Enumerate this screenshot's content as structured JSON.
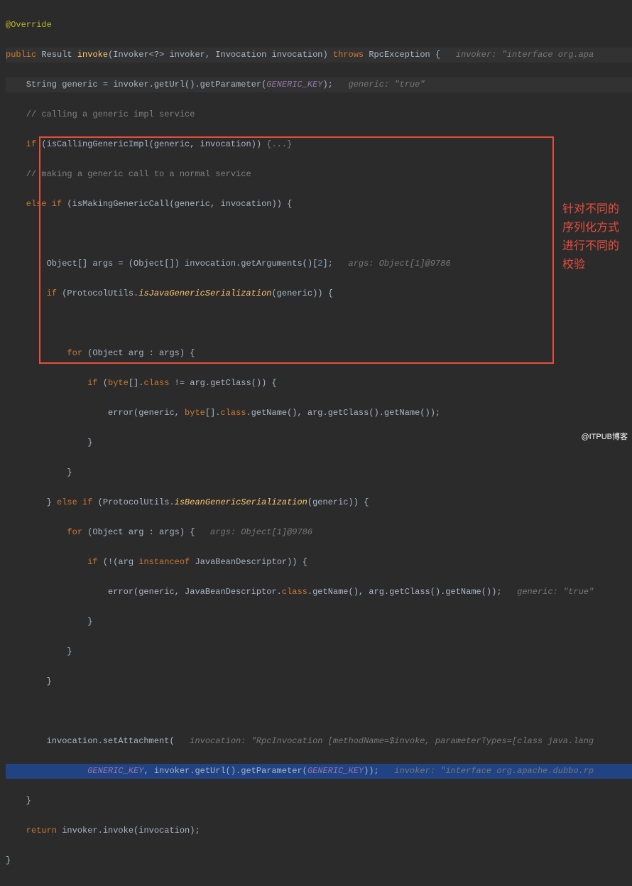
{
  "code": {
    "l1a": "@Override",
    "l2_kw1": "public ",
    "l2_ret": "Result ",
    "l2_mth": "invoke",
    "l2_p": "(Invoker<?> invoker, Invocation invocation) ",
    "l2_kw2": "throws ",
    "l2_ex": "RpcException {",
    "l2_hint": "   invoker: \"interface org.apa",
    "l3_a": "    String generic = invoker.getUrl().getParameter(",
    "l3_b": "GENERIC_KEY",
    "l3_c": ");",
    "l3_hint": "   generic: \"true\"",
    "l4": "    // calling a generic impl service",
    "l5_a": "    if ",
    "l5_b": "(isCallingGenericImpl(generic, invocation)) ",
    "l5_c": "{...}",
    "l6": "    // making a generic call to a normal service",
    "l7_a": "    else if ",
    "l7_b": "(isMakingGenericCall(generic, invocation)) {",
    "l8": "",
    "l9_a": "        Object[] args = (Object[]) invocation.getArguments()[",
    "l9_b": "2",
    "l9_c": "];",
    "l9_hint": "   args: Object[1]@9786",
    "l10_a": "        if ",
    "l10_b": "(ProtocolUtils.",
    "l10_c": "isJavaGenericSerialization",
    "l10_d": "(generic)) {",
    "l11": "",
    "l12_a": "            for ",
    "l12_b": "(Object arg : args) {",
    "l13_a": "                if ",
    "l13_b": "(",
    "l13_c": "byte",
    "l13_d": "[].",
    "l13_e": "class ",
    "l13_f": "!= arg.getClass()) {",
    "l14_a": "                    error(generic, ",
    "l14_b": "byte",
    "l14_c": "[].",
    "l14_d": "class",
    "l14_e": ".getName(), arg.getClass().getName());",
    "l15": "                }",
    "l16": "            }",
    "l17_a": "        } ",
    "l17_b": "else if ",
    "l17_c": "(ProtocolUtils.",
    "l17_d": "isBeanGenericSerialization",
    "l17_e": "(generic)) {",
    "l18_a": "            for ",
    "l18_b": "(Object arg : args) {",
    "l18_hint": "   args: Object[1]@9786",
    "l19_a": "                if ",
    "l19_b": "(!(arg ",
    "l19_c": "instanceof ",
    "l19_d": "JavaBeanDescriptor)) {",
    "l20_a": "                    error(generic, JavaBeanDescriptor.",
    "l20_b": "class",
    "l20_c": ".getName(), arg.getClass().getName());",
    "l20_hint": "   generic: \"true\"",
    "l21": "                }",
    "l22": "            }",
    "l23": "        }",
    "l24": "",
    "l25_a": "        invocation.setAttachment(",
    "l25_hint": "   invocation: \"RpcInvocation [methodName=$invoke, parameterTypes=[class java.lang",
    "l26_a": "                ",
    "l26_b": "GENERIC_KEY",
    "l26_c": ", invoker.getUrl().getParameter(",
    "l26_d": "GENERIC_KEY",
    "l26_e": "));",
    "l26_hint": "   invoker: \"interface org.apache.dubbo.rp",
    "l27": "    }",
    "l28_a": "    return ",
    "l28_b": "invoker.invoke(invocation);",
    "l29": "}"
  },
  "annotation": {
    "line1": "针对不同的",
    "line2": "序列化方式",
    "line3": "进行不同的",
    "line4": "校验"
  },
  "watermark": "@ITPUB博客"
}
